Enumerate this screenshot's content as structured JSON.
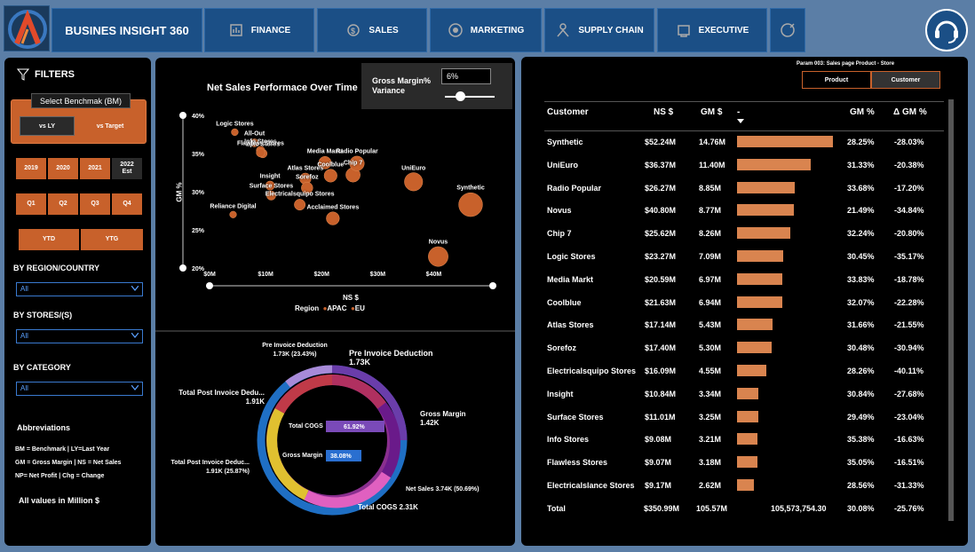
{
  "header": {
    "brand": "BUSINES INSIGHT 360",
    "nav": [
      {
        "label": "FINANCE",
        "icon": "finance-icon"
      },
      {
        "label": "SALES",
        "icon": "sales-icon"
      },
      {
        "label": "MARKETING",
        "icon": "marketing-icon"
      },
      {
        "label": "SUPPLY CHAIN",
        "icon": "supply-chain-icon"
      },
      {
        "label": "EXECUTIVE",
        "icon": "executive-icon"
      }
    ]
  },
  "filters": {
    "title": "FILTERS",
    "benchmark_tooltip": "Select Benchmak (BM)",
    "bm_options": [
      "vs LY",
      "vs Target"
    ],
    "years": [
      "2019",
      "2020",
      "2021",
      "2022 Est"
    ],
    "quarters": [
      "Q1",
      "Q2",
      "Q3",
      "Q4"
    ],
    "periods": [
      "YTD",
      "YTG"
    ],
    "region_label": "BY REGION/COUNTRY",
    "region_value": "All",
    "stores_label": "BY STORES/(S)",
    "stores_value": "All",
    "category_label": "BY CATEGORY",
    "category_value": "All",
    "abbr_title": "Abbreviations",
    "abbr_lines": [
      "BM = Benchmark | LY=Last Year",
      "GM = Gross Margin | NS = Net Sales",
      "NP= Net Profit | Chg = Change"
    ],
    "all_values": "All values in Million $"
  },
  "scatter": {
    "title": "Net Sales Performace Over Time",
    "gm_variance_label": "Gross Margin% Variance",
    "gm_variance_value": "6%",
    "ylabel": "GM %",
    "xlabel": "NS $",
    "legend_title": "Region",
    "legend_items": [
      "APAC",
      "EU"
    ]
  },
  "chart_data": [
    {
      "type": "scatter",
      "title": "Net Sales Performace Over Time",
      "xlabel": "NS $",
      "ylabel": "GM %",
      "xlim": [
        0,
        45
      ],
      "ylim": [
        20,
        40
      ],
      "x_ticks": [
        "$0M",
        "$10M",
        "$20M",
        "$30M",
        "$40M"
      ],
      "y_ticks": [
        "40%",
        "35%",
        "30%",
        "25%",
        "20%"
      ],
      "legend": [
        "APAC",
        "EU"
      ],
      "points": [
        {
          "label": "Logic Stores",
          "x": 4.5,
          "y": 37.8
        },
        {
          "label": "All-Out",
          "x": 8.0,
          "y": 36.4
        },
        {
          "label": "Epic Stores",
          "x": 9.5,
          "y": 35.0
        },
        {
          "label": "Media Markt",
          "x": 20.6,
          "y": 33.8
        },
        {
          "label": "Chip 7",
          "x": 25.6,
          "y": 32.2
        },
        {
          "label": "Info Stores",
          "x": 9.1,
          "y": 35.4
        },
        {
          "label": "Insight",
          "x": 10.8,
          "y": 30.8
        },
        {
          "label": "Atlas Stores",
          "x": 17.1,
          "y": 31.7
        },
        {
          "label": "Radio Popular",
          "x": 26.3,
          "y": 33.7
        },
        {
          "label": "Surface Stores",
          "x": 11.0,
          "y": 29.5
        },
        {
          "label": "Coolblue",
          "x": 21.6,
          "y": 32.1
        },
        {
          "label": "Sorefoz",
          "x": 17.4,
          "y": 30.5
        },
        {
          "label": "UniEuro",
          "x": 36.4,
          "y": 31.3
        },
        {
          "label": "Reliance Digital",
          "x": 4.2,
          "y": 27.0
        },
        {
          "label": "Electricalsquipo Stores",
          "x": 16.1,
          "y": 28.3
        },
        {
          "label": "Synthetic",
          "x": 52.2,
          "y": 28.3
        },
        {
          "label": "Flawless Stores",
          "x": 9.1,
          "y": 35.1
        },
        {
          "label": "Acclaimed Stores",
          "x": 22.0,
          "y": 26.5
        },
        {
          "label": "Novus",
          "x": 40.8,
          "y": 21.5
        }
      ]
    },
    {
      "type": "pie",
      "title": "",
      "labels": [
        "Pre Invoice Deduction",
        "Total Post Invoice Dedu...",
        "Gross Margin",
        "Net Sales",
        "Total COGS"
      ],
      "values": [
        1.73,
        1.91,
        1.42,
        3.74,
        2.31
      ],
      "pct_labels": [
        "Pre Invoice Deduction\n1.73K (23.43%)",
        "Total Post Invoice Deduc...\n1.91K (25.87%)",
        "Net Sales 3.74K (50.69%)"
      ],
      "inner_bars": [
        {
          "name": "Total COGS",
          "value": 61.92,
          "label": "61.92%"
        },
        {
          "name": "Gross Margin",
          "value": 38.08,
          "label": "38.08%"
        }
      ]
    }
  ],
  "donut": {
    "outer_labels": [
      {
        "title": "Pre Invoice Deduction",
        "value": "1.73K (23.43%)"
      },
      {
        "title": "Pre Invoice Deduction",
        "value": "1.73K"
      },
      {
        "title": "Total Post Invoice Dedu...",
        "value": "1.91K"
      },
      {
        "title": "Gross Margin",
        "value": "1.42K"
      },
      {
        "title": "Total Post Invoice Deduc...",
        "value": "1.91K (25.87%)"
      },
      {
        "title": "Net Sales 3.74K (50.69%)",
        "value": ""
      },
      {
        "title": "Total COGS 2.31K",
        "value": ""
      }
    ],
    "inner": [
      {
        "label": "Total COGS",
        "pct": "61.92%"
      },
      {
        "label": "Gross Margin",
        "pct": "38.08%"
      }
    ]
  },
  "table": {
    "param": "Param 003: Sales page Product - Store",
    "toggles": [
      "Product",
      "Customer"
    ],
    "columns": [
      "Customer",
      "NS $",
      "GM $",
      "-",
      "GM %",
      "Δ GM %"
    ],
    "rows": [
      {
        "customer": "Synthetic",
        "ns": "$52.24M",
        "gm": "14.76M",
        "bar": 14.76,
        "gmp": "28.25%",
        "dgm": "-28.03%"
      },
      {
        "customer": "UniEuro",
        "ns": "$36.37M",
        "gm": "11.40M",
        "bar": 11.4,
        "gmp": "31.33%",
        "dgm": "-20.38%"
      },
      {
        "customer": "Radio Popular",
        "ns": "$26.27M",
        "gm": "8.85M",
        "bar": 8.85,
        "gmp": "33.68%",
        "dgm": "-17.20%"
      },
      {
        "customer": "Novus",
        "ns": "$40.80M",
        "gm": "8.77M",
        "bar": 8.77,
        "gmp": "21.49%",
        "dgm": "-34.84%"
      },
      {
        "customer": "Chip 7",
        "ns": "$25.62M",
        "gm": "8.26M",
        "bar": 8.26,
        "gmp": "32.24%",
        "dgm": "-20.80%"
      },
      {
        "customer": "Logic Stores",
        "ns": "$23.27M",
        "gm": "7.09M",
        "bar": 7.09,
        "gmp": "30.45%",
        "dgm": "-35.17%"
      },
      {
        "customer": "Media Markt",
        "ns": "$20.59M",
        "gm": "6.97M",
        "bar": 6.97,
        "gmp": "33.83%",
        "dgm": "-18.78%"
      },
      {
        "customer": "Coolblue",
        "ns": "$21.63M",
        "gm": "6.94M",
        "bar": 6.94,
        "gmp": "32.07%",
        "dgm": "-22.28%"
      },
      {
        "customer": "Atlas Stores",
        "ns": "$17.14M",
        "gm": "5.43M",
        "bar": 5.43,
        "gmp": "31.66%",
        "dgm": "-21.55%"
      },
      {
        "customer": "Sorefoz",
        "ns": "$17.40M",
        "gm": "5.30M",
        "bar": 5.3,
        "gmp": "30.48%",
        "dgm": "-30.94%"
      },
      {
        "customer": "Electricalsquipo Stores",
        "ns": "$16.09M",
        "gm": "4.55M",
        "bar": 4.55,
        "gmp": "28.26%",
        "dgm": "-40.11%"
      },
      {
        "customer": "Insight",
        "ns": "$10.84M",
        "gm": "3.34M",
        "bar": 3.34,
        "gmp": "30.84%",
        "dgm": "-27.68%"
      },
      {
        "customer": "Surface Stores",
        "ns": "$11.01M",
        "gm": "3.25M",
        "bar": 3.25,
        "gmp": "29.49%",
        "dgm": "-23.04%"
      },
      {
        "customer": "Info Stores",
        "ns": "$9.08M",
        "gm": "3.21M",
        "bar": 3.21,
        "gmp": "35.38%",
        "dgm": "-16.63%"
      },
      {
        "customer": "Flawless Stores",
        "ns": "$9.07M",
        "gm": "3.18M",
        "bar": 3.18,
        "gmp": "35.05%",
        "dgm": "-16.51%"
      },
      {
        "customer": "Electricalslance Stores",
        "ns": "$9.17M",
        "gm": "2.62M",
        "bar": 2.62,
        "gmp": "28.56%",
        "dgm": "-31.33%"
      }
    ],
    "total": {
      "customer": "Total",
      "ns": "$350.99M",
      "gm": "105.57M",
      "bar_value": "105,573,754.30",
      "gmp": "30.08%",
      "dgm": "-25.76%"
    }
  },
  "colors": {
    "accent": "#c8612b",
    "bar": "#d9844f",
    "nav": "#1b4f86",
    "bg": "#5b7ea6"
  }
}
